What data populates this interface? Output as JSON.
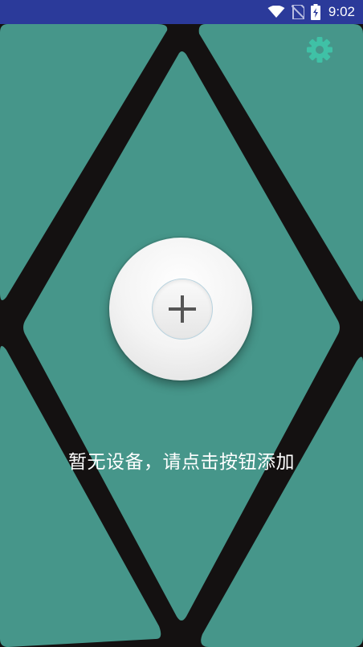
{
  "status_bar": {
    "time": "9:02",
    "icons": [
      "wifi-icon",
      "no-sim-icon",
      "battery-charging-icon"
    ]
  },
  "header": {
    "settings_icon": "gear-icon"
  },
  "main": {
    "add_button_icon": "plus-icon",
    "empty_message": "暂无设备，请点击按钮添加"
  },
  "colors": {
    "status_bar": "#2b3a9a",
    "panel_teal": "#46968a",
    "grid_lines": "#141111",
    "settings_icon": "#3fc1a6",
    "text": "#ffffff"
  }
}
